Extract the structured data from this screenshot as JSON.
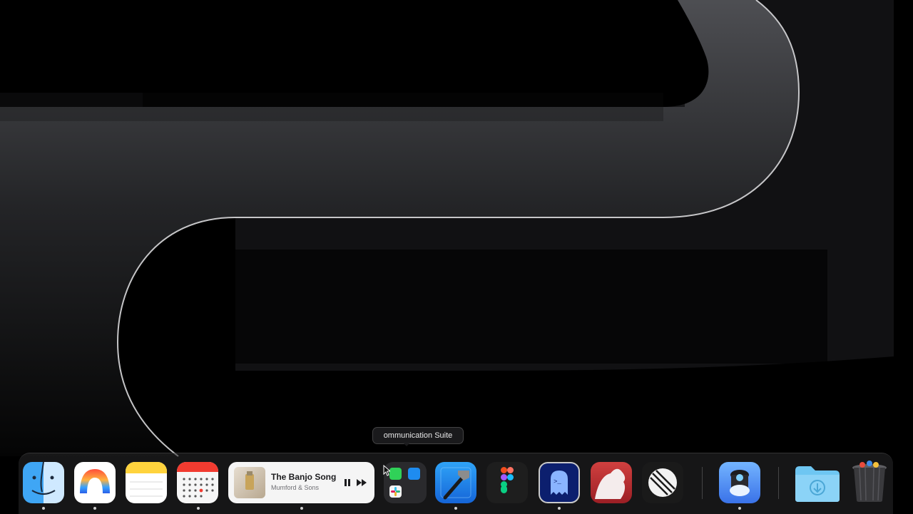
{
  "desktop": {
    "accent": "#1d8bf7"
  },
  "tooltip": {
    "text": "ommunication Suite"
  },
  "now_playing": {
    "title": "The Banjo Song",
    "artist": "Mumford & Sons",
    "state": "playing"
  },
  "dock": {
    "apps": [
      {
        "name": "finder",
        "icon": "finder-icon",
        "running": true
      },
      {
        "name": "arc",
        "icon": "arc-browser-icon",
        "running": true
      },
      {
        "name": "notes",
        "icon": "notes-icon",
        "running": false
      },
      {
        "name": "calendar",
        "icon": "calendar-icon",
        "running": true
      },
      {
        "name": "communication-suite-folder",
        "icon": "folder-icon",
        "running": false
      },
      {
        "name": "xcode",
        "icon": "xcode-hammer-icon",
        "running": true
      },
      {
        "name": "figma",
        "icon": "figma-icon",
        "running": false
      },
      {
        "name": "terminal-ghost",
        "icon": "ghost-terminal-icon",
        "running": true
      },
      {
        "name": "bear",
        "icon": "bear-icon",
        "running": false
      },
      {
        "name": "linear",
        "icon": "linear-icon",
        "running": false
      },
      {
        "name": "cleanup-app",
        "icon": "cleanup-icon",
        "running": true
      },
      {
        "name": "downloads",
        "icon": "downloads-folder-icon",
        "running": false
      },
      {
        "name": "trash",
        "icon": "trash-icon",
        "running": false
      }
    ]
  }
}
